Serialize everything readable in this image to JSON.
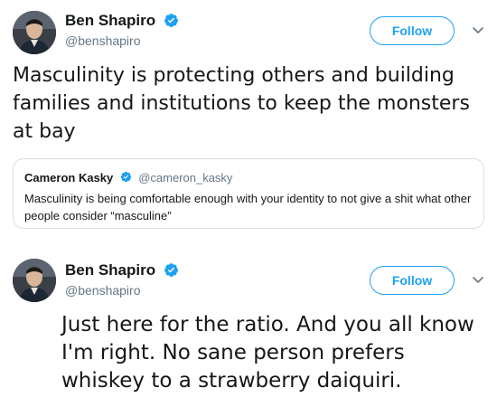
{
  "tweets": [
    {
      "author": {
        "name": "Ben Shapiro",
        "handle": "@benshapiro",
        "verified": true
      },
      "follow_label": "Follow",
      "text": "Masculinity is protecting others and building families and institutions to keep the monsters at bay",
      "quote": {
        "author": {
          "name": "Cameron Kasky",
          "handle": "@cameron_kasky",
          "verified": true
        },
        "text": "Masculinity is being comfortable enough with your identity to not give a shit what other people consider “masculine”"
      }
    },
    {
      "author": {
        "name": "Ben Shapiro",
        "handle": "@benshapiro",
        "verified": true
      },
      "follow_label": "Follow",
      "text": "Just here for the ratio. And you all know I'm right. No sane person prefers whiskey to a strawberry daiquiri."
    }
  ],
  "colors": {
    "accent": "#1da1f2",
    "text_primary": "#14171a",
    "text_secondary": "#657786",
    "border": "#d9dfe4"
  },
  "icons": {
    "verified": "verified-badge-icon",
    "chevron": "chevron-down-icon",
    "avatar": "avatar-photo"
  }
}
